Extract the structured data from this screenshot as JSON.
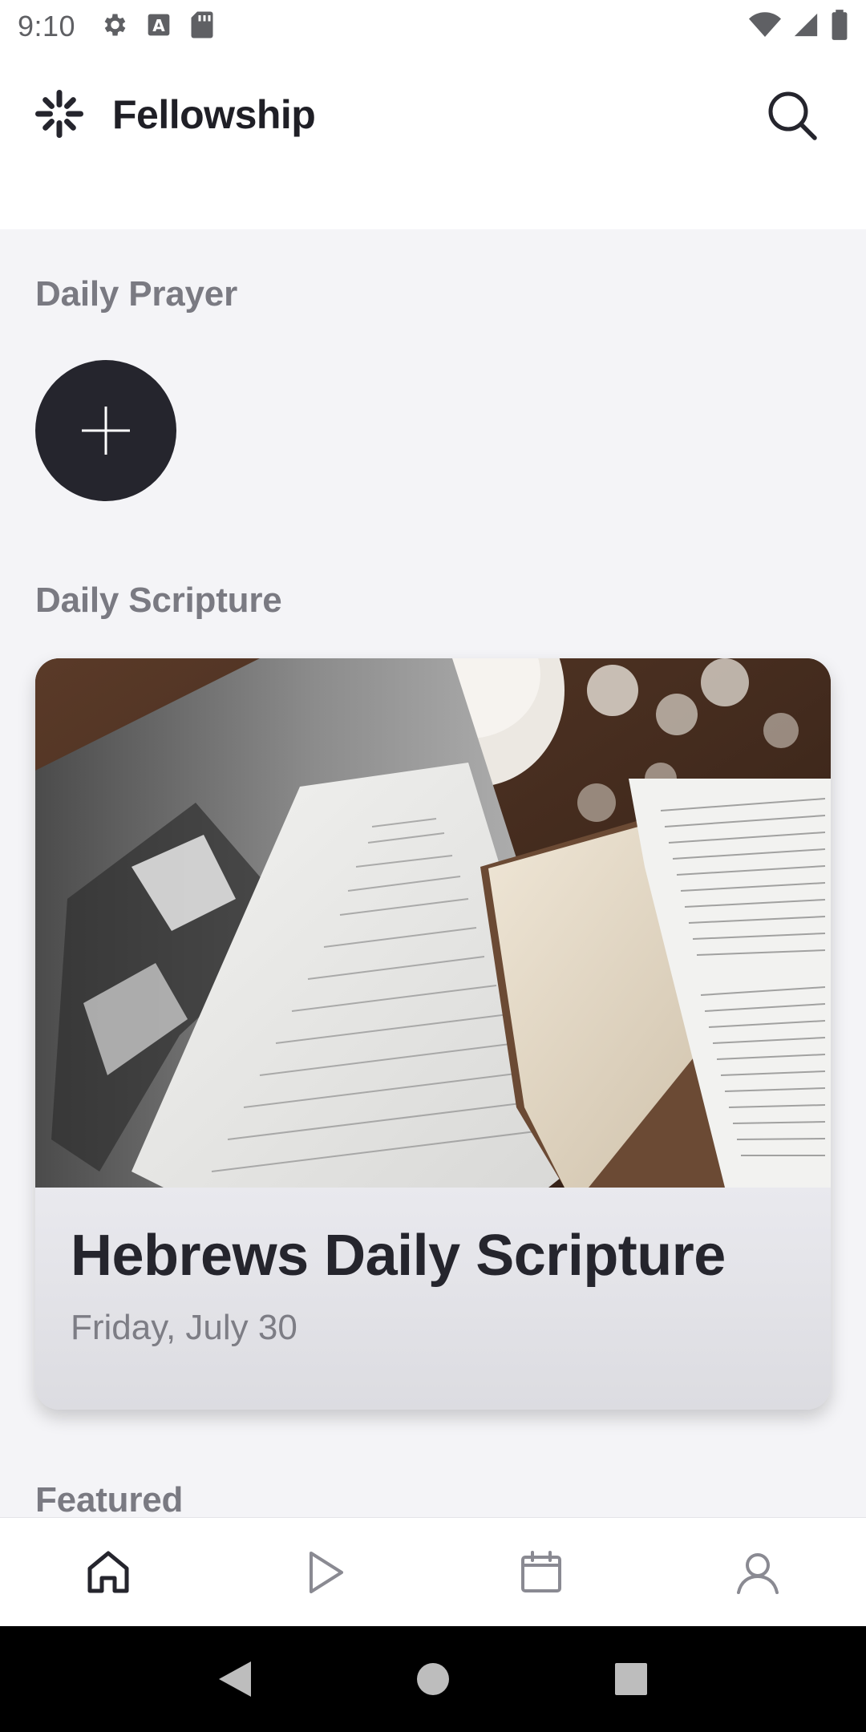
{
  "status_bar": {
    "time": "9:10",
    "left_icons": [
      "gear-icon",
      "a-icon",
      "sd-card-icon"
    ],
    "right_icons": [
      "wifi-icon",
      "signal-icon",
      "battery-icon"
    ]
  },
  "header": {
    "brand_name": "Fellowship",
    "logo_icon": "fellowship-logo-icon",
    "search_icon": "search-icon"
  },
  "sections": {
    "daily_prayer": {
      "title": "Daily Prayer",
      "add_button_icon": "plus-icon"
    },
    "daily_scripture": {
      "title": "Daily Scripture",
      "card": {
        "title": "Hebrews Daily Scripture",
        "date": "Friday, July 30",
        "image": "open-bible-photo"
      }
    },
    "featured": {
      "title": "Featured"
    }
  },
  "bottom_nav": {
    "items": [
      {
        "icon": "home-icon",
        "active": true
      },
      {
        "icon": "play-icon",
        "active": false
      },
      {
        "icon": "calendar-icon",
        "active": false
      },
      {
        "icon": "profile-icon",
        "active": false
      }
    ]
  },
  "system_nav": [
    "back-icon",
    "home-circle-icon",
    "recents-icon"
  ],
  "colors": {
    "background": "#f4f4f7",
    "dark": "#25252d",
    "section_title": "#7a7a82",
    "card_body": "#e7e7eb",
    "date_text": "#7d7d85"
  }
}
